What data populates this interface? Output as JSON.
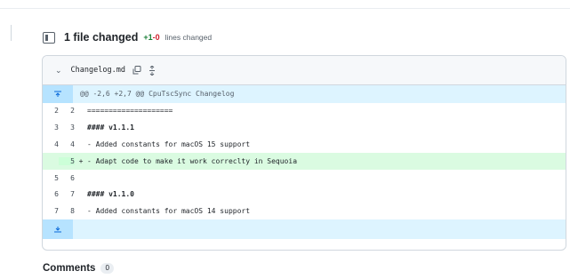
{
  "summary": {
    "files_changed": "1 file changed",
    "additions": "+1",
    "deletions": "-0",
    "lines_changed": "lines changed"
  },
  "file": {
    "name": "Changelog.md"
  },
  "hunk_header": "@@ -2,6 +2,7 @@ CpuTscSync Changelog",
  "rows": [
    {
      "old": "2",
      "new": "2",
      "marker": "",
      "text": "===================="
    },
    {
      "old": "3",
      "new": "3",
      "marker": "",
      "text": "#### v1.1.1"
    },
    {
      "old": "4",
      "new": "4",
      "marker": "",
      "text": "- Added constants for macOS 15 support"
    },
    {
      "old": "",
      "new": "5",
      "marker": "+",
      "text": "- Adapt code to make it work correclty in Sequoia"
    },
    {
      "old": "5",
      "new": "6",
      "marker": "",
      "text": ""
    },
    {
      "old": "6",
      "new": "7",
      "marker": "",
      "text": "#### v1.1.0"
    },
    {
      "old": "7",
      "new": "8",
      "marker": "",
      "text": "- Added constants for macOS 14 support"
    }
  ],
  "comments": {
    "title": "Comments",
    "count": "0"
  },
  "colors": {
    "addition_green": "#1a7f37",
    "deletion_red": "#cf222e",
    "hunk_blue": "#ddf4ff",
    "added_line_bg": "#dafbe1"
  }
}
